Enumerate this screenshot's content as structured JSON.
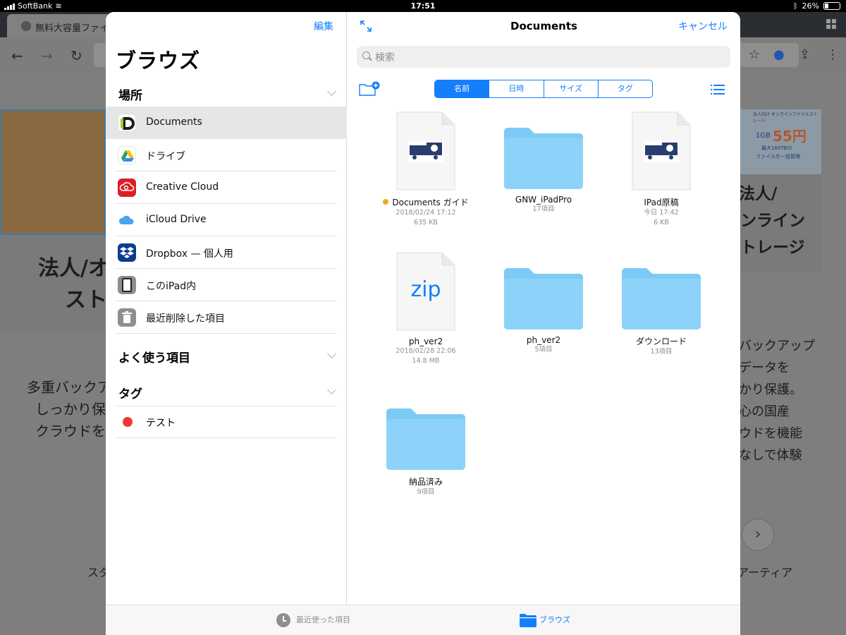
{
  "statusbar": {
    "carrier": "SoftBank",
    "time": "17:51",
    "battery": "26%"
  },
  "browser": {
    "tab_title": "無料大容量ファイル",
    "bg_left_heading_1": "法人/オ",
    "bg_left_heading_2": "スト",
    "bg_left_text_1": "多重バックア",
    "bg_left_text_2": "しっかり保",
    "bg_left_text_3": "クラウドを",
    "bg_left_bottom": "スタ",
    "bg_right_heading_1": "法人/",
    "bg_right_heading_2": "ンライン",
    "bg_right_heading_3": "トレージ",
    "bg_right_text_1": "バックアップ",
    "bg_right_text_2": "データを",
    "bg_right_text_3": "かり保護。",
    "bg_right_text_4": "心の国産",
    "bg_right_text_5": "ウドを機能",
    "bg_right_text_6": "なしで体験",
    "bg_right_bottom": "アーティア",
    "ad_text_1": "1GB",
    "ad_text_2": "55円",
    "ad_text_3": "最大160TBの",
    "ad_text_4": "ファイルを一括管理",
    "ad_header": "法人向け オンラインファイルストレージ"
  },
  "sidebar": {
    "edit_label": "編集",
    "title": "ブラウズ",
    "locations_header": "場所",
    "locations": [
      {
        "label": "Documents",
        "icon": "documents-app-icon"
      },
      {
        "label": "ドライブ",
        "icon": "google-drive-icon"
      },
      {
        "label": "Creative Cloud",
        "icon": "creative-cloud-icon"
      },
      {
        "label": "iCloud Drive",
        "icon": "icloud-drive-icon"
      },
      {
        "label": "Dropbox — 個人用",
        "icon": "dropbox-icon"
      },
      {
        "label": "このiPad内",
        "icon": "ipad-icon"
      },
      {
        "label": "最近削除した項目",
        "icon": "trash-icon"
      }
    ],
    "favorites_header": "よく使う項目",
    "tags_header": "タグ",
    "tags": [
      {
        "label": "テスト",
        "color": "#EE3B30"
      }
    ]
  },
  "main": {
    "title": "Documents",
    "cancel_label": "キャンセル",
    "search_placeholder": "検索",
    "sort_options": [
      "名前",
      "日時",
      "サイズ",
      "タグ"
    ],
    "active_sort": "名前",
    "files": [
      {
        "name": "Documents ガイド",
        "line1": "2018/02/24 17:12",
        "line2": "635 KB",
        "kind": "document",
        "tagged": true
      },
      {
        "name": "GNW_iPadPro",
        "line1": "17項目",
        "line2": "",
        "kind": "folder"
      },
      {
        "name": "IPad原稿",
        "line1": "今日 17:42",
        "line2": "6 KB",
        "kind": "document"
      },
      {
        "name": "ph_ver2",
        "line1": "2018/02/28 22:06",
        "line2": "14.8 MB",
        "kind": "zip",
        "thumb_text": "zip"
      },
      {
        "name": "ph_ver2",
        "line1": "5項目",
        "line2": "",
        "kind": "folder"
      },
      {
        "name": "ダウンロード",
        "line1": "13項目",
        "line2": "",
        "kind": "folder"
      },
      {
        "name": "納品済み",
        "line1": "9項目",
        "line2": "",
        "kind": "folder"
      }
    ]
  },
  "tabbar": {
    "recents_label": "最近使った項目",
    "browse_label": "ブラウズ"
  },
  "colors": {
    "accent": "#147EFB",
    "folder": "#8DD3F9",
    "tag_orange": "#F5A623"
  }
}
